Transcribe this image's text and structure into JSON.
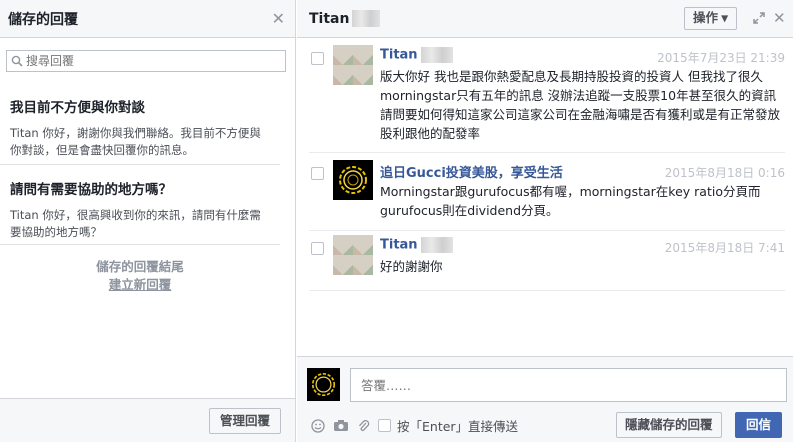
{
  "left": {
    "title": "儲存的回覆",
    "search_placeholder": "搜尋回覆",
    "replies": [
      {
        "title": "我目前不方便與你對談",
        "body": "Titan 你好，謝謝你與我們聯絡。我目前不方便與你對談，但是會盡快回覆你的訊息。"
      },
      {
        "title": "請問有需要協助的地方嗎？",
        "body": "Titan 你好，很高興收到你的來訊，請問有什麼需要協助的地方嗎？"
      }
    ],
    "end_label": "儲存的回覆結尾",
    "new_reply_link": "建立新回覆",
    "manage_button": "管理回覆"
  },
  "conversation": {
    "title": "Titan",
    "actions_label": "操作",
    "messages": [
      {
        "name": "Titan",
        "time": "2015年7月23日 21:39",
        "text": "版大你好 我也是跟你熱愛配息及長期持股投資的投資人 但我找了很久morningstar只有五年的訊息 沒辦法追蹤一支股票10年甚至很久的資訊 請問要如何得知這家公司這家公司在金融海嘯是否有獲利或是有正常發放股利跟他的配發率"
      },
      {
        "name": "追日Gucci投資美股，享受生活",
        "time": "2015年8月18日 0:16",
        "text": "Morningstar跟gurufocus都有喔，morningstar在key ratio分頁而gurufocus則在dividend分頁。"
      },
      {
        "name": "Titan",
        "time": "2015年8月18日 7:41",
        "text": "好的謝謝你"
      }
    ],
    "composer": {
      "placeholder": "答覆……",
      "enter_label": "按「Enter」直接傳送",
      "hide_button": "隱藏儲存的回覆",
      "send_button": "回信"
    }
  }
}
